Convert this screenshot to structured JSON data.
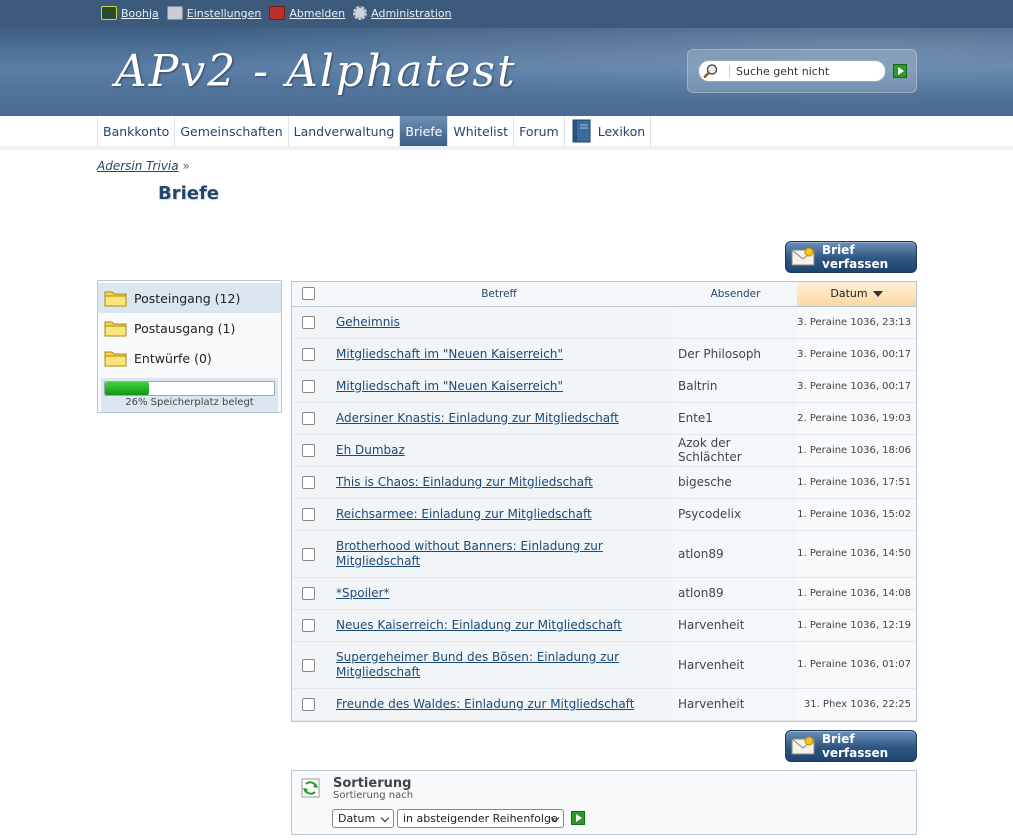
{
  "topbar": {
    "links": [
      {
        "label": "Boohja",
        "icon": "user-icon"
      },
      {
        "label": "Einstellungen",
        "icon": "settings-icon"
      },
      {
        "label": "Abmelden",
        "icon": "logout-icon"
      },
      {
        "label": "Administration",
        "icon": "gear-icon"
      }
    ]
  },
  "header": {
    "logo": "APv2 - Alphatest",
    "search": {
      "value": "Suche geht nicht",
      "placeholder": ""
    }
  },
  "nav": {
    "items": [
      {
        "label": "Bankkonto"
      },
      {
        "label": "Gemeinschaften"
      },
      {
        "label": "Landverwaltung"
      },
      {
        "label": "Briefe",
        "active": true
      },
      {
        "label": "Whitelist"
      },
      {
        "label": "Forum"
      },
      {
        "label": "Lexikon",
        "icon": "book-icon"
      }
    ]
  },
  "breadcrumb": {
    "link": "Adersin Trivia",
    "separator": "»"
  },
  "page": {
    "title": "Briefe",
    "compose_label": "Brief verfassen"
  },
  "folders": {
    "items": [
      {
        "label": "Posteingang (12)",
        "active": true
      },
      {
        "label": "Postausgang (1)"
      },
      {
        "label": "Entwürfe (0)"
      }
    ],
    "storage": {
      "percent": 26,
      "label": "26% Speicherplatz belegt"
    }
  },
  "table": {
    "headers": {
      "subject": "Betreff",
      "sender": "Absender",
      "date": "Datum"
    },
    "rows": [
      {
        "subject": "Geheimnis",
        "sender": "",
        "date": "3. Peraine 1036, 23:13"
      },
      {
        "subject": "Mitgliedschaft im \"Neuen Kaiserreich\"",
        "sender": "Der Philosoph",
        "date": "3. Peraine 1036, 00:17"
      },
      {
        "subject": "Mitgliedschaft im \"Neuen Kaiserreich\"",
        "sender": "Baltrin",
        "date": "3. Peraine 1036, 00:17"
      },
      {
        "subject": "Adersiner Knastis: Einladung zur Mitgliedschaft",
        "sender": "Ente1",
        "date": "2. Peraine 1036, 19:03"
      },
      {
        "subject": "Eh Dumbaz",
        "sender": "Azok der Schlächter",
        "date": "1. Peraine 1036, 18:06"
      },
      {
        "subject": "This is Chaos: Einladung zur Mitgliedschaft",
        "sender": "bigesche",
        "date": "1. Peraine 1036, 17:51"
      },
      {
        "subject": "Reichsarmee: Einladung zur Mitgliedschaft",
        "sender": "Psycodelix",
        "date": "1. Peraine 1036, 15:02"
      },
      {
        "subject": "Brotherhood without Banners: Einladung zur Mitgliedschaft",
        "sender": "atlon89",
        "date": "1. Peraine 1036, 14:50"
      },
      {
        "subject": "*Spoiler*",
        "sender": "atlon89",
        "date": "1. Peraine 1036, 14:08"
      },
      {
        "subject": "Neues Kaiserreich: Einladung zur Mitgliedschaft",
        "sender": "Harvenheit",
        "date": "1. Peraine 1036, 12:19"
      },
      {
        "subject": "Supergeheimer Bund des Bösen: Einladung zur Mitgliedschaft",
        "sender": "Harvenheit",
        "date": "1. Peraine 1036, 01:07"
      },
      {
        "subject": "Freunde des Waldes: Einladung zur Mitgliedschaft",
        "sender": "Harvenheit",
        "date": "31. Phex 1036, 22:25"
      }
    ]
  },
  "sort": {
    "title": "Sortierung",
    "subtitle": "Sortierung nach",
    "field": "Datum",
    "order": "in absteigender Reihenfolge"
  }
}
